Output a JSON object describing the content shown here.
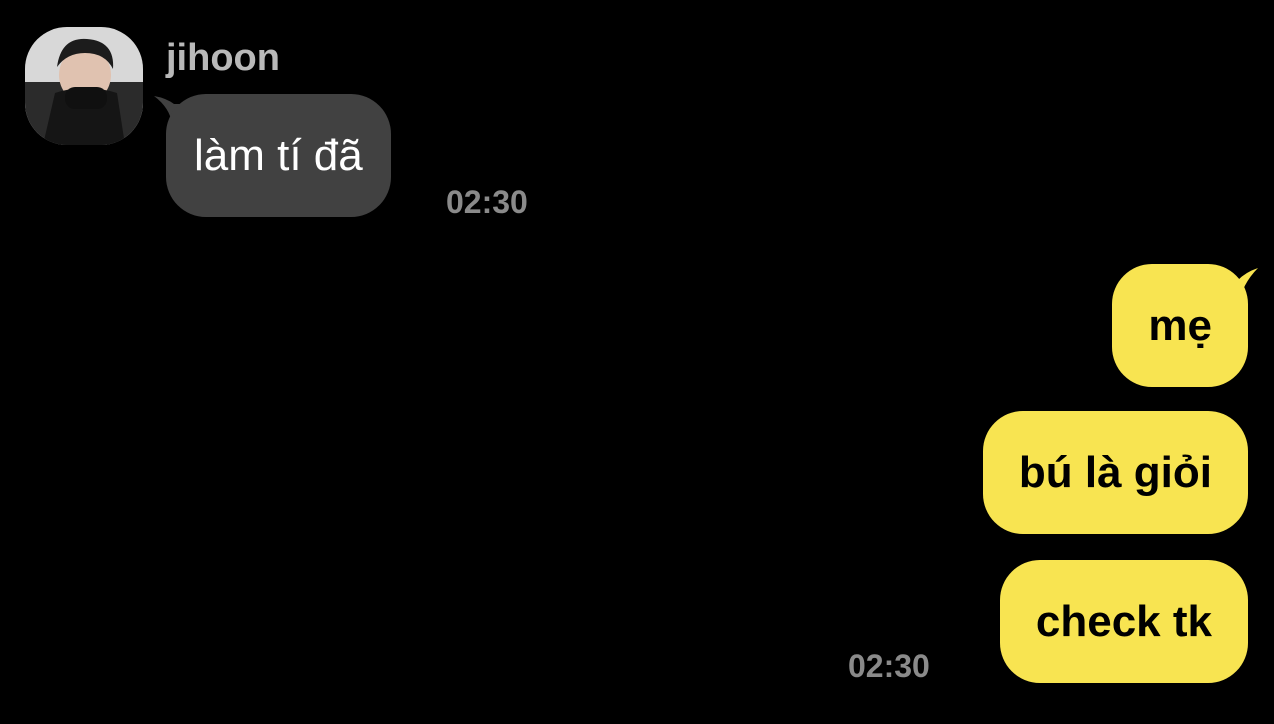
{
  "incoming": {
    "sender_name": "jihoon",
    "message": "làm tí đã",
    "time": "02:30"
  },
  "outgoing": {
    "messages": [
      "mẹ",
      "bú là giỏi",
      "check tk"
    ],
    "time": "02:30"
  },
  "colors": {
    "background": "#000000",
    "incoming_bubble": "#414141",
    "outgoing_bubble": "#f8e451",
    "timestamp": "#8a8a8a",
    "sender_name": "#b9b9b9"
  },
  "icons": {
    "avatar": "profile-photo"
  }
}
